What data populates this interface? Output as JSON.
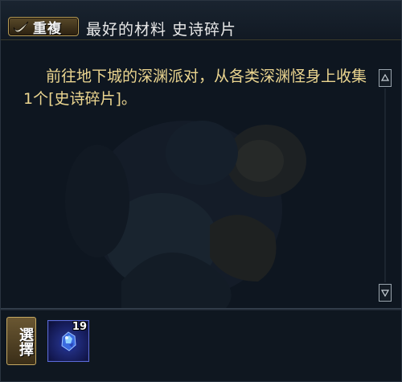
{
  "header": {
    "repeat_label": "重複",
    "title": "最好的材料 史诗碎片"
  },
  "quest": {
    "description": "前往地下城的深渊派对，从各类深渊怪身上收集1个[史诗碎片]。"
  },
  "scroll": {
    "up_icon": "up-arrow-icon",
    "down_icon": "down-arrow-icon"
  },
  "footer": {
    "choose_label": "選擇",
    "reward": {
      "icon": "blue-crystal-icon",
      "count": "19"
    }
  },
  "colors": {
    "description_text": "#ecd690",
    "title_text": "#e9e9e9",
    "badge_border": "#b59a55",
    "reward_border": "#5a6ad8"
  }
}
